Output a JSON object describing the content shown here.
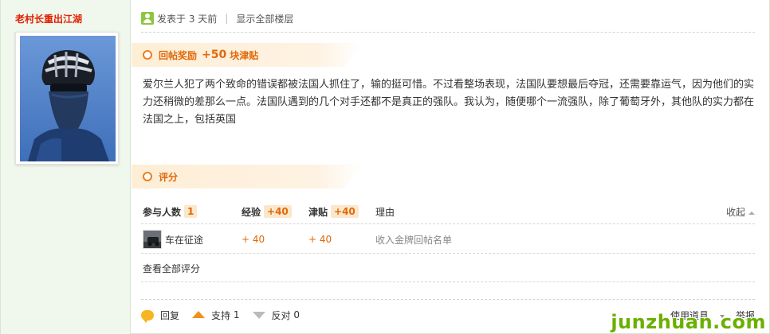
{
  "author": {
    "name": "老村长重出江湖"
  },
  "meta": {
    "posted": "发表于 3 天前",
    "show_all_floors": "显示全部楼层"
  },
  "reward": {
    "label": "回帖奖励",
    "amount": "+50",
    "unit": "块津贴"
  },
  "post": {
    "text": "爱尔兰人犯了两个致命的错误都被法国人抓住了，输的挺可惜。不过看整场表现，法国队要想最后夺冠，还需要靠运气，因为他们的实力还稍微的差那么一点。法国队遇到的几个对手还都不是真正的强队。我认为，随便哪个一流强队，除了葡萄牙外，其他队的实力都在法国之上，包括英国"
  },
  "rating": {
    "section_title": "评分",
    "participants_label": "参与人数",
    "participants_count": "1",
    "exp_label": "经验",
    "exp_total": "+40",
    "allowance_label": "津贴",
    "allowance_total": "+40",
    "reason_label": "理由",
    "collapse_label": "收起",
    "rows": [
      {
        "user": "车在征途",
        "exp": "+ 40",
        "allowance": "+ 40",
        "reason": "收入金牌回帖名单"
      }
    ],
    "view_all": "查看全部评分"
  },
  "actions": {
    "reply": "回复",
    "support": "支持",
    "support_count": "1",
    "oppose": "反对",
    "oppose_count": "0",
    "use_tool": "使用道具",
    "report": "举报"
  },
  "watermark": "junzhuan.com",
  "colors": {
    "author_name": "#e02000",
    "accent_orange": "#e06a0a",
    "sidebar_bg": "#f0f7ec",
    "watermark": "#6bb000"
  }
}
